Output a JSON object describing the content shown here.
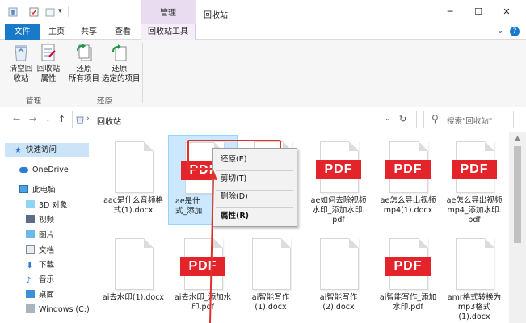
{
  "window": {
    "manage_tab": "管理",
    "title": "回收站",
    "controls": {
      "minimize": "─",
      "maximize": "☐",
      "close": "✕"
    }
  },
  "ribbon_tabs": [
    "文件",
    "主页",
    "共享",
    "查看",
    "回收站工具"
  ],
  "ribbon": {
    "groups": [
      {
        "label": "管理",
        "buttons": [
          "清空回\n收站",
          "回收站\n属性"
        ]
      },
      {
        "label": "还原",
        "buttons": [
          "还原\n所有项目",
          "还原\n选定的项目"
        ]
      }
    ]
  },
  "address": {
    "path": "回收站",
    "search_placeholder": "搜索\"回收站\""
  },
  "nav": {
    "items": [
      "快速访问",
      "OneDrive",
      "此电脑",
      "3D 对象",
      "视频",
      "图片",
      "文档",
      "下载",
      "音乐",
      "桌面",
      "Windows (C:)"
    ]
  },
  "files": [
    {
      "name": "aac是什么音频格\n式(1).docx",
      "type": "docx"
    },
    {
      "name": "ae是什\n式_添加",
      "type": "pdf"
    },
    {
      "name": "",
      "type": "docx"
    },
    {
      "name": "ae如何去除视频\n水印_添加水印.\npdf",
      "type": "pdf"
    },
    {
      "name": "ae怎么导出视频\nmp4(1).docx",
      "type": "pdf"
    },
    {
      "name": "ae怎么导出视频\nmp4_添加水印.\npdf",
      "type": "pdf"
    },
    {
      "name": "ai去水印(1).docx",
      "type": "docx"
    },
    {
      "name": "ai去水印_添加水\n印.pdf",
      "type": "pdf"
    },
    {
      "name": "ai智能写作\n(1).docx",
      "type": "docx"
    },
    {
      "name": "ai智能写作\n(2).docx",
      "type": "docx"
    },
    {
      "name": "ai智能写作_添加\n水印.pdf",
      "type": "pdf"
    },
    {
      "name": "amr格式转换为\nmp3格式\n(1).docx",
      "type": "docx"
    }
  ],
  "context_menu": {
    "items": [
      "还原(E)",
      "剪切(T)",
      "删除(D)",
      "属性(R)"
    ]
  },
  "pdf_label": "PDF",
  "colors": {
    "file_tab": "#1979ca",
    "manage_tab": "#e9dcf0",
    "pdf_red": "#e3242b",
    "annotation_red": "#e0312b",
    "selection": "#cce8ff"
  }
}
